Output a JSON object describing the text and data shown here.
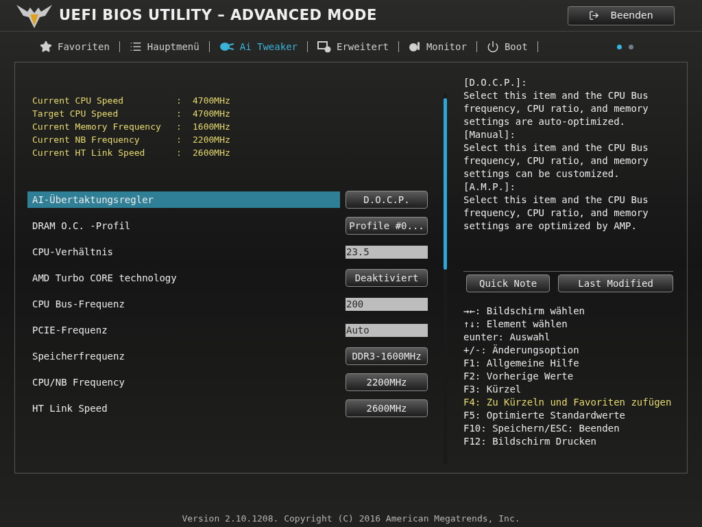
{
  "header": {
    "title": "UEFI BIOS UTILITY – ADVANCED MODE",
    "exit_button": "Beenden"
  },
  "tabs": [
    {
      "label": "Favoriten",
      "selected": false
    },
    {
      "label": "Hauptmenü",
      "selected": false
    },
    {
      "label": "Ai Tweaker",
      "selected": true
    },
    {
      "label": "Erweitert",
      "selected": false
    },
    {
      "label": "Monitor",
      "selected": false
    },
    {
      "label": "Boot",
      "selected": false
    }
  ],
  "page_dots": [
    {
      "selected": true
    },
    {
      "selected": false
    }
  ],
  "info": [
    {
      "label": "Current CPU Speed",
      "separator": ":",
      "value": "4700MHz"
    },
    {
      "label": "Target CPU Speed",
      "separator": ":",
      "value": "4700MHz"
    },
    {
      "label": "Current Memory Frequency",
      "separator": ":",
      "value": "1600MHz"
    },
    {
      "label": "Current NB Frequency",
      "separator": ":",
      "value": "2200MHz"
    },
    {
      "label": "Current HT Link Speed",
      "separator": ":",
      "value": "2600MHz"
    }
  ],
  "settings": [
    {
      "label": "AI-Übertaktungsregler",
      "kind": "button",
      "value": "D.O.C.P.",
      "selected": true
    },
    {
      "label": "DRAM O.C. -Profil",
      "kind": "button",
      "value": "Profile #0...",
      "selected": false
    },
    {
      "label": "CPU-Verhältnis",
      "kind": "field",
      "value": "23.5",
      "selected": false
    },
    {
      "label": "AMD Turbo CORE technology",
      "kind": "button",
      "value": "Deaktiviert",
      "selected": false
    },
    {
      "label": "CPU Bus-Frequenz",
      "kind": "field",
      "value": "200",
      "selected": false
    },
    {
      "label": "PCIE-Frequenz",
      "kind": "field",
      "value": "Auto",
      "selected": false
    },
    {
      "label": "Speicherfrequenz",
      "kind": "button",
      "value": "DDR3-1600MHz",
      "selected": false
    },
    {
      "label": "CPU/NB Frequency",
      "kind": "button",
      "value": "2200MHz",
      "selected": false
    },
    {
      "label": "HT Link Speed",
      "kind": "button",
      "value": "2600MHz",
      "selected": false
    }
  ],
  "help_text": [
    "[D.O.C.P.]:",
    "Select this item and the CPU Bus frequency, CPU ratio, and memory settings are auto-optimized.",
    "[Manual]:",
    "Select this item and the CPU Bus frequency, CPU ratio, and memory settings can be customized.",
    "[A.M.P.]:",
    "Select this item and the CPU Bus frequency, CPU ratio, and memory settings are optimized by AMP."
  ],
  "side_buttons": [
    "Quick Note",
    "Last Modified"
  ],
  "key_help": [
    {
      "text": "→←: Bildschirm wählen",
      "highlighted": false
    },
    {
      "text": "↑↓: Element wählen",
      "highlighted": false
    },
    {
      "text": "eunter: Auswahl",
      "highlighted": false
    },
    {
      "text": "+/-: Änderungsoption",
      "highlighted": false
    },
    {
      "text": "F1: Allgemeine Hilfe",
      "highlighted": false
    },
    {
      "text": "F2: Vorherige Werte",
      "highlighted": false
    },
    {
      "text": "F3: Kürzel",
      "highlighted": false
    },
    {
      "text": "F4: Zu Kürzeln und Favoriten zufügen",
      "highlighted": true
    },
    {
      "text": "F5: Optimierte Standardwerte",
      "highlighted": false
    },
    {
      "text": "F10: Speichern/ESC: Beenden",
      "highlighted": false
    },
    {
      "text": "F12: Bildschirm Drucken",
      "highlighted": false
    }
  ],
  "footer": "Version 2.10.1208. Copyright (C) 2016 American Megatrends, Inc."
}
